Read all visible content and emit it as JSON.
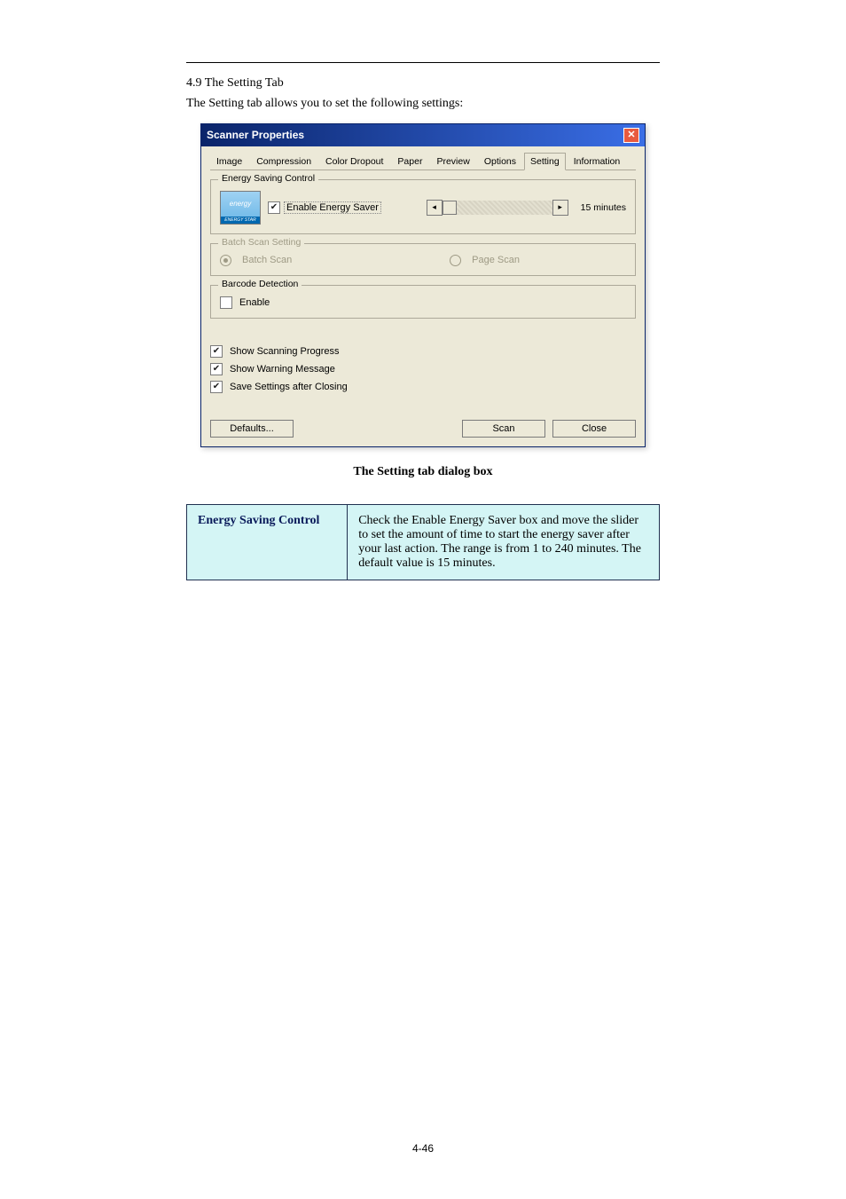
{
  "page": {
    "section_title_1": "4.9 The Setting Tab",
    "section_body_1": "The Setting tab allows you to set the following settings:",
    "dialog_caption": "The Setting tab dialog box",
    "page_number": "4-46"
  },
  "dialog": {
    "title": "Scanner Properties",
    "tabs": [
      "Image",
      "Compression",
      "Color Dropout",
      "Paper",
      "Preview",
      "Options",
      "Setting",
      "Information"
    ],
    "active_tab": "Setting",
    "energy": {
      "legend": "Energy Saving Control",
      "logo_text": "energy",
      "logo_band": "ENERGY STAR",
      "checkbox_label": "Enable Energy Saver",
      "checkbox_checked": true,
      "minutes": "15 minutes"
    },
    "batch": {
      "legend": "Batch Scan Setting",
      "radio1": "Batch Scan",
      "radio2": "Page Scan"
    },
    "barcode": {
      "legend": "Barcode Detection",
      "checkbox_label": "Enable",
      "checkbox_checked": false
    },
    "checks": {
      "progress": {
        "label": "Show Scanning Progress",
        "checked": true
      },
      "warning": {
        "label": "Show Warning Message",
        "checked": true
      },
      "save": {
        "label": "Save Settings after Closing",
        "checked": true
      }
    },
    "buttons": {
      "defaults": "Defaults...",
      "scan": "Scan",
      "close": "Close"
    }
  },
  "table": {
    "r1c1": "Energy Saving Control",
    "r1c2": "Check the Enable Energy Saver box and move the slider to set the amount of time to start the energy saver after your last action.  The range is from 1 to 240 minutes.  The default value is 15 minutes."
  }
}
